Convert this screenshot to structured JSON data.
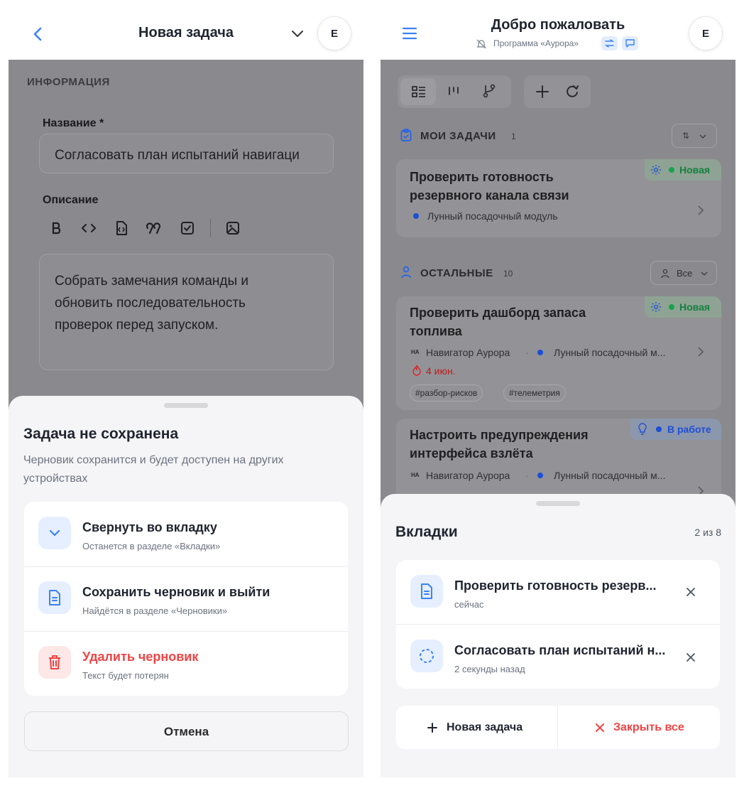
{
  "left": {
    "header": {
      "title": "Новая задача",
      "avatar": "E"
    },
    "section_label": "ИНФОРМАЦИЯ",
    "name_field": {
      "label": "Название *",
      "value": "Согласовать план испытаний навигаци"
    },
    "description": {
      "label": "Описание",
      "text": "Собрать замечания команды и обновить последовательность проверок перед запуском."
    },
    "dialog": {
      "title": "Задача не сохранена",
      "subtitle": "Черновик сохранится и будет доступен на других устройствах",
      "options": [
        {
          "title": "Свернуть во вкладку",
          "sub": "Останется в разделе «Вкладки»"
        },
        {
          "title": "Сохранить черновик и выйти",
          "sub": "Найдётся в разделе «Черновики»"
        },
        {
          "title": "Удалить черновик",
          "sub": "Текст будет потерян"
        }
      ],
      "cancel": "Отмена"
    }
  },
  "right": {
    "header": {
      "title": "Добро пожаловать",
      "program": "Программа «Аурора»",
      "avatar": "E"
    },
    "my_tasks": {
      "label": "МОИ ЗАДАЧИ",
      "count": "1",
      "items": [
        {
          "title": "Проверить готовность резервного канала связи",
          "status": "Новая",
          "module": "Лунный посадочный модуль"
        }
      ]
    },
    "others": {
      "label": "ОСТАЛЬНЫЕ",
      "count": "10",
      "filter": "Все",
      "items": [
        {
          "title": "Проверить дашборд запаса топлива",
          "status": "Новая",
          "assignee_initials": "НА",
          "assignee": "Навигатор Аурора",
          "module": "Лунный посадочный м...",
          "due": "4 июн.",
          "tags": [
            "#разбор-рисков",
            "#телеметрия"
          ]
        },
        {
          "title": "Настроить предупреждения интерфейса взлёта",
          "status": "В работе",
          "assignee_initials": "НА",
          "assignee": "Навигатор Аурора",
          "module": "Лунный посадочный м..."
        }
      ]
    },
    "tabs_sheet": {
      "title": "Вкладки",
      "counter": "2 из 8",
      "tabs": [
        {
          "title": "Проверить готовность резерв...",
          "time": "сейчас"
        },
        {
          "title": "Согласовать план испытаний н...",
          "time": "2 секунды назад"
        }
      ],
      "new_task": "Новая задача",
      "close_all": "Закрыть все"
    }
  },
  "colors": {
    "accent": "#3b82f6",
    "danger": "#ef4444",
    "status_new": "#22c55e",
    "status_progress": "#2563eb"
  }
}
